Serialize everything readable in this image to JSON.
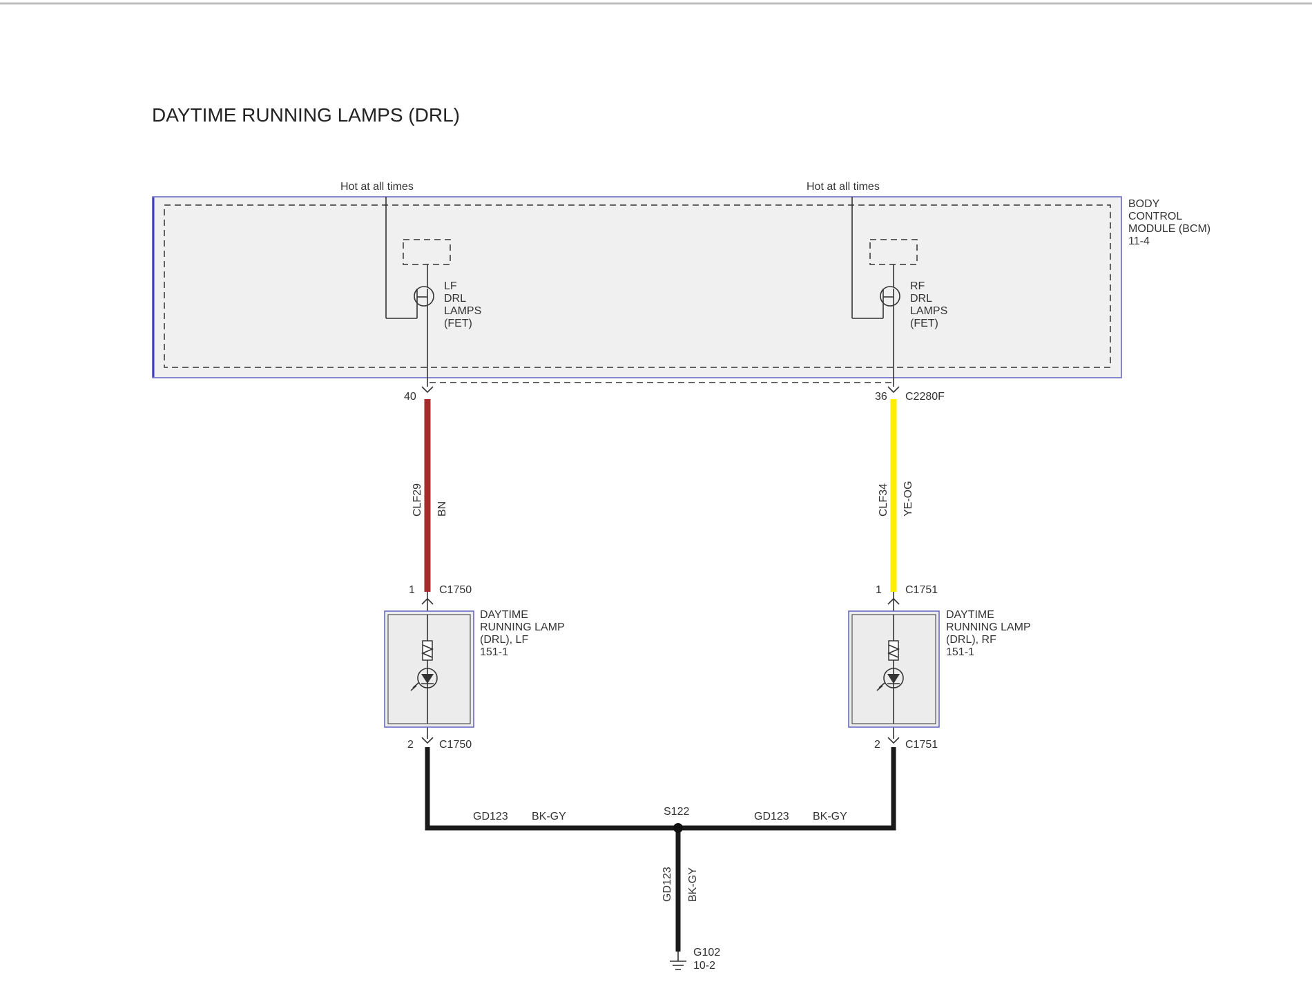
{
  "title": "DAYTIME RUNNING LAMPS (DRL)",
  "bcm": {
    "lines": [
      "BODY",
      "CONTROL",
      "MODULE (BCM)",
      "11-4"
    ],
    "hot_left": "Hot at all times",
    "hot_right": "Hot at all times",
    "lf_fet": [
      "LF",
      "DRL",
      "LAMPS",
      "(FET)"
    ],
    "rf_fet": [
      "RF",
      "DRL",
      "LAMPS",
      "(FET)"
    ],
    "connector": "C2280F",
    "pin_left": "40",
    "pin_right": "36"
  },
  "wires": {
    "left": {
      "circuit": "CLF29",
      "color_code": "BN",
      "color": "#a52a2a"
    },
    "right": {
      "circuit": "CLF34",
      "color_code": "YE-OG",
      "color": "#ffee00"
    },
    "ground_color": "#1a1a1a",
    "ground_left": {
      "circuit": "GD123",
      "color_code": "BK-GY"
    },
    "ground_right": {
      "circuit": "GD123",
      "color_code": "BK-GY"
    },
    "ground_down": {
      "circuit": "GD123",
      "color_code": "BK-GY"
    }
  },
  "lf_lamp": {
    "pin_top": "1",
    "connector_top": "C1750",
    "pin_bottom": "2",
    "connector_bottom": "C1750",
    "lines": [
      "DAYTIME",
      "RUNNING LAMP",
      "(DRL), LF",
      "151-1"
    ]
  },
  "rf_lamp": {
    "pin_top": "1",
    "connector_top": "C1751",
    "pin_bottom": "2",
    "connector_bottom": "C1751",
    "lines": [
      "DAYTIME",
      "RUNNING LAMP",
      "(DRL), RF",
      "151-1"
    ]
  },
  "splice": "S122",
  "ground": {
    "lines": [
      "G102",
      "10-2"
    ]
  }
}
